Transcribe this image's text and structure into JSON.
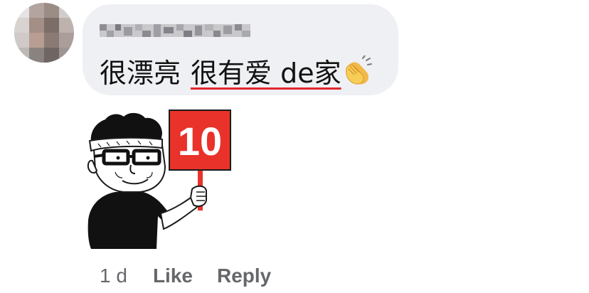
{
  "comment": {
    "text_plain": "很漂亮",
    "text_linked": "很有爱 de家",
    "emoji_icon": "clapping-hands-icon"
  },
  "sticker": {
    "sign_number": "10",
    "sign_color": "#e8322a"
  },
  "meta": {
    "time": "1 d",
    "like_label": "Like",
    "reply_label": "Reply"
  },
  "colors": {
    "bubble": "#eff0f3",
    "text": "#121212",
    "meta": "#65676b",
    "underline": "#e0262e"
  }
}
